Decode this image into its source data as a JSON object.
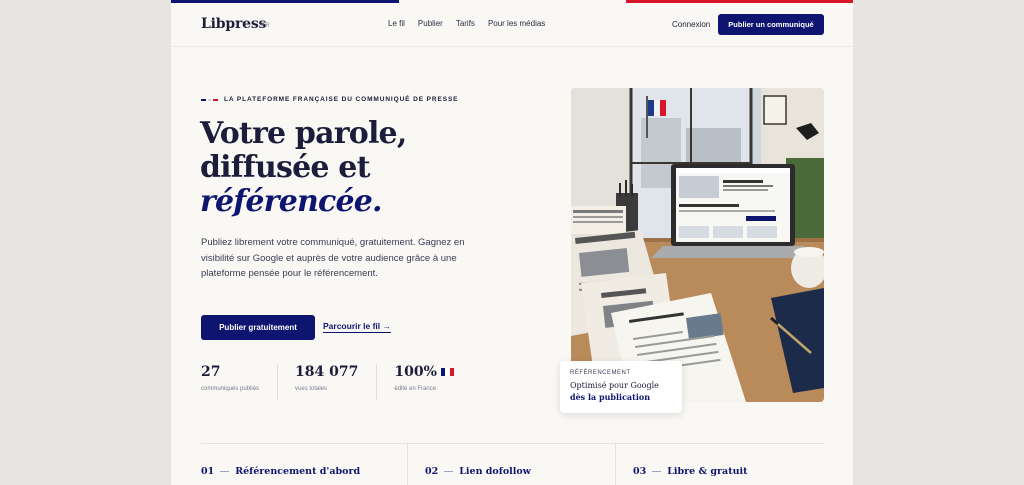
{
  "brand": {
    "name": "Libpress",
    "suffix": ".FR"
  },
  "nav": {
    "items": [
      "Le fil",
      "Publier",
      "Tarifs",
      "Pour les médias"
    ]
  },
  "header": {
    "login": "Connexion",
    "cta": "Publier un communiqué"
  },
  "hero": {
    "eyebrow": "LA PLATEFORME FRANÇAISE DU COMMUNIQUÉ DE PRESSE",
    "title_line1": "Votre parole,",
    "title_line2": "diffusée et",
    "title_accent": "référencée.",
    "lead": "Publiez librement votre communiqué, gratuitement. Gagnez en visibilité sur Google et auprès de votre audience grâce à une plateforme pensée pour le référencement.",
    "primary_cta": "Publier gratuitement",
    "secondary_cta": "Parcourir le fil →"
  },
  "stats": [
    {
      "value": "27",
      "label": "communiqués publiés"
    },
    {
      "value": "184 077",
      "label": "vues totales"
    },
    {
      "value": "100%",
      "label": "édité en France"
    }
  ],
  "badge": {
    "label": "RÉFÉRENCEMENT",
    "line1": "Optimisé pour Google",
    "line2": "dès la publication"
  },
  "features": [
    {
      "num": "01",
      "title": "Référencement d'abord"
    },
    {
      "num": "02",
      "title": "Lien dofollow"
    },
    {
      "num": "03",
      "title": "Libre & gratuit"
    }
  ],
  "colors": {
    "brand_blue": "#0d1570",
    "flag_red": "#d8162a",
    "background": "#faf8f4"
  }
}
